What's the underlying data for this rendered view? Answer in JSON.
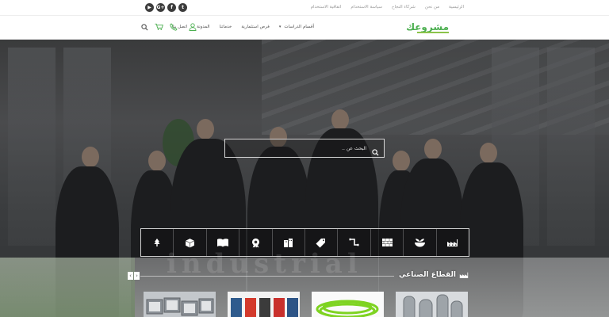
{
  "topbar": {
    "social": [
      {
        "icon": "youtube-icon",
        "glyph": "▶"
      },
      {
        "icon": "google-plus-icon",
        "glyph": "G+"
      },
      {
        "icon": "facebook-icon",
        "glyph": "f"
      },
      {
        "icon": "twitter-icon",
        "glyph": "t"
      }
    ],
    "links": [
      "الرئيسية",
      "من نحن",
      "شركاء النجاح",
      "سياسة الاستخدام",
      "اتفاقية الاستخدام"
    ]
  },
  "nav": {
    "logo": "مشروعك",
    "menu": [
      "أقسام الدراسات",
      "فرص استثمارية",
      "خدماتنا",
      "المدونة",
      "اتصل بنا"
    ],
    "icons": [
      "user-icon",
      "phone-icon",
      "cart-icon",
      "search-icon"
    ]
  },
  "hero": {
    "search_placeholder": "البحث عن ..",
    "categories": [
      "factory-icon",
      "plant-bowl-icon",
      "bricks-icon",
      "pipe-icon",
      "tag-icon",
      "buildings-icon",
      "badge-icon",
      "book-icon",
      "box-icon",
      "tree-icon"
    ]
  },
  "section": {
    "title": "القطاع الصناعي",
    "watermark": "industrial",
    "products": [
      "steel-pipes-image",
      "panels-image",
      "green-rope-image",
      "pipes-image"
    ]
  },
  "colors": {
    "brand": "#4caf50",
    "accent": "#8bc34a"
  }
}
